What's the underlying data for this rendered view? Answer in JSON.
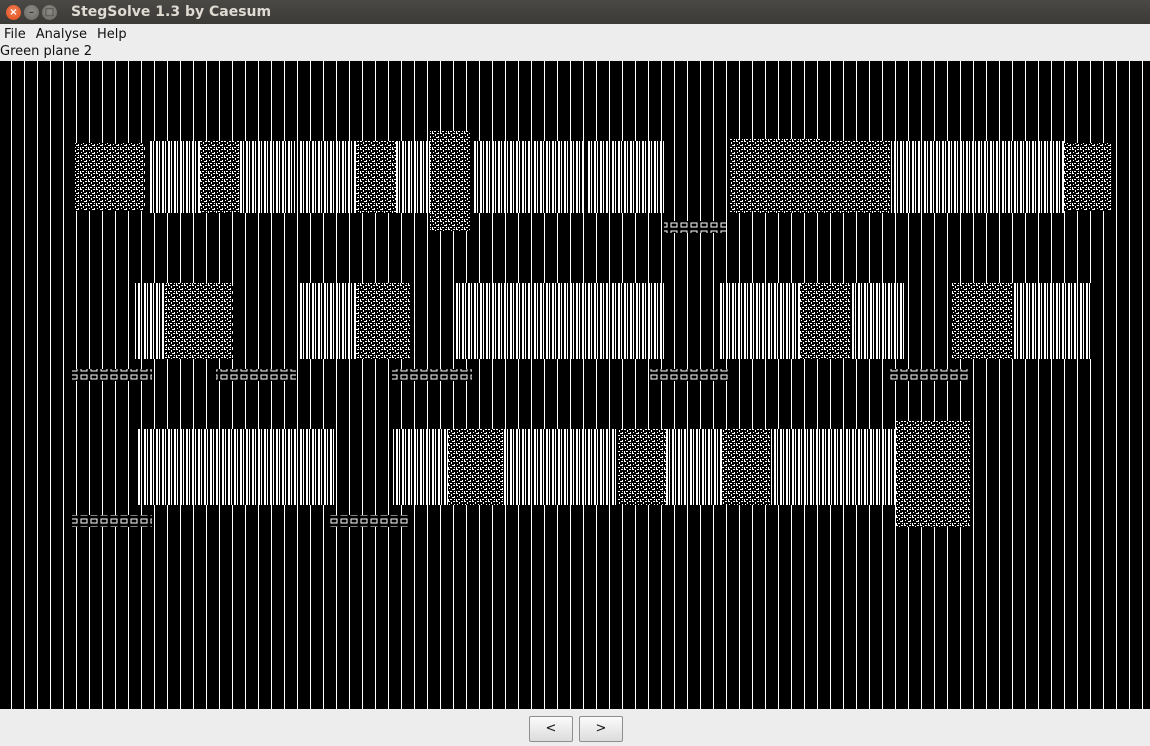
{
  "window": {
    "title": "StegSolve 1.3 by Caesum",
    "close_glyph": "×",
    "min_glyph": "–",
    "max_glyph": "□"
  },
  "menu": {
    "items": [
      "File",
      "Analyse",
      "Help"
    ]
  },
  "viewer": {
    "plane_label": "Green plane 2"
  },
  "navigation": {
    "prev_label": "<",
    "next_label": ">"
  }
}
